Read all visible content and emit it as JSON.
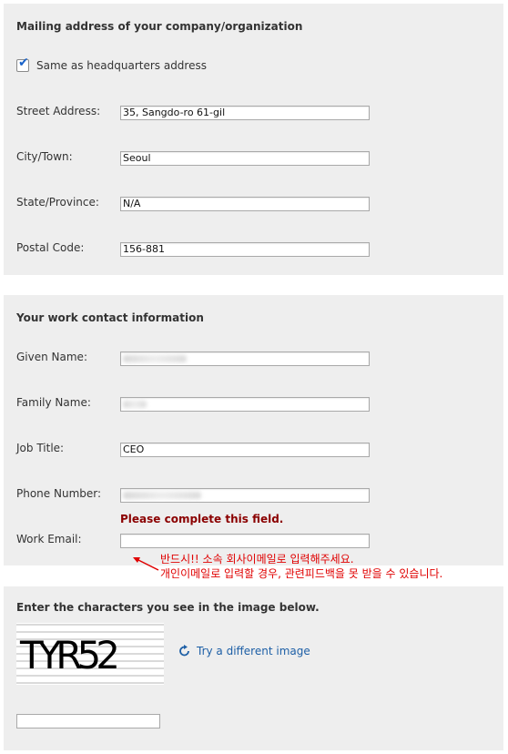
{
  "mailing": {
    "heading": "Mailing address of your company/organization",
    "same_as_hq_label": "Same as headquarters address",
    "same_as_hq_checked": true,
    "street_label": "Street Address:",
    "street_value": "35, Sangdo-ro 61-gil",
    "city_label": "City/Town:",
    "city_value": "Seoul",
    "state_label": "State/Province:",
    "state_value": "N/A",
    "postal_label": "Postal Code:",
    "postal_value": "156-881"
  },
  "contact": {
    "heading": "Your work contact information",
    "given_label": "Given Name:",
    "given_value": "",
    "family_label": "Family Name:",
    "family_value": "",
    "job_label": "Job Title:",
    "job_value": "CEO",
    "phone_label": "Phone Number:",
    "phone_value": "",
    "error_text": "Please complete this field.",
    "email_label": "Work Email:",
    "email_value": "",
    "annotation_line1": "반드시!! 소속 회사이메일로 입력해주세요.",
    "annotation_line2": "개인이메일로 입력할 경우, 관련피드백을 못 받을 수 있습니다.",
    "error_color": "#8b0000",
    "annotation_color": "#e00000"
  },
  "captcha": {
    "heading": "Enter the characters you see in the image below.",
    "image_text": "TYR52",
    "try_label": "Try a different image",
    "try_icon": "refresh-icon",
    "input_value": "",
    "link_color": "#1d5fa6"
  }
}
